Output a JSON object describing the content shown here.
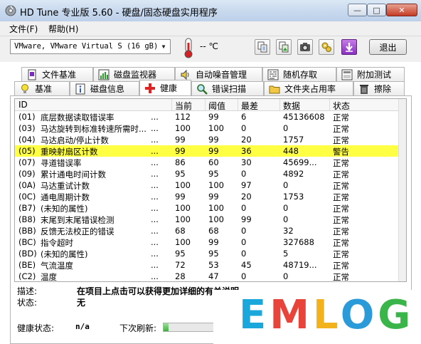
{
  "window": {
    "title": "HD Tune 专业版 5.60 - 硬盘/固态硬盘实用程序",
    "btn_min": "—",
    "btn_max": "□",
    "btn_close": "✕"
  },
  "menu": {
    "file": "文件(F)",
    "help": "帮助(H)"
  },
  "toolbar": {
    "drive": "VMware, VMware Virtual S (16 gB)",
    "temperature": "-- ℃",
    "exit": "退出"
  },
  "tabs_top": [
    {
      "label": "文件基准",
      "icon": "file-benchmark-icon"
    },
    {
      "label": "磁盘监视器",
      "icon": "disk-monitor-icon"
    },
    {
      "label": "自动噪音管理",
      "icon": "speaker-icon"
    },
    {
      "label": "随机存取",
      "icon": "random-access-icon"
    },
    {
      "label": "附加测试",
      "icon": "extra-tests-icon"
    }
  ],
  "tabs_bottom": [
    {
      "label": "基准",
      "icon": "lightbulb-icon"
    },
    {
      "label": "磁盘信息",
      "icon": "info-icon"
    },
    {
      "label": "健康",
      "icon": "health-cross-icon"
    },
    {
      "label": "错误扫描",
      "icon": "magnifier-icon"
    },
    {
      "label": "文件夹占用率",
      "icon": "folder-icon"
    },
    {
      "label": "擦除",
      "icon": "trash-icon"
    }
  ],
  "table": {
    "columns": [
      "ID",
      "当前",
      "阈值",
      "最差",
      "数据",
      "状态"
    ],
    "rows": [
      {
        "id": "(01)",
        "name": "底层数据读取错误率",
        "dots": "...",
        "current": "112",
        "threshold": "99",
        "worst": "6",
        "data": "45136608",
        "status": "正常"
      },
      {
        "id": "(03)",
        "name": "马达旋转到标准转速所需时...",
        "dots": "...",
        "current": "100",
        "threshold": "100",
        "worst": "0",
        "data": "0",
        "status": "正常"
      },
      {
        "id": "(04)",
        "name": "马达启动/停止计数",
        "dots": "...",
        "current": "99",
        "threshold": "99",
        "worst": "20",
        "data": "1757",
        "status": "正常"
      },
      {
        "id": "(05)",
        "name": "重映射扇区计数",
        "dots": "...",
        "current": "99",
        "threshold": "99",
        "worst": "36",
        "data": "448",
        "status": "警告"
      },
      {
        "id": "(07)",
        "name": "寻道错误率",
        "dots": "...",
        "current": "86",
        "threshold": "60",
        "worst": "30",
        "data": "45699...",
        "status": "正常"
      },
      {
        "id": "(09)",
        "name": "累计通电时间计数",
        "dots": "...",
        "current": "95",
        "threshold": "95",
        "worst": "0",
        "data": "4892",
        "status": "正常"
      },
      {
        "id": "(0A)",
        "name": "马达重试计数",
        "dots": "...",
        "current": "100",
        "threshold": "100",
        "worst": "97",
        "data": "0",
        "status": "正常"
      },
      {
        "id": "(0C)",
        "name": "通电周期计数",
        "dots": "...",
        "current": "99",
        "threshold": "99",
        "worst": "20",
        "data": "1753",
        "status": "正常"
      },
      {
        "id": "(B7)",
        "name": "(未知的属性)",
        "dots": "...",
        "current": "100",
        "threshold": "100",
        "worst": "0",
        "data": "0",
        "status": "正常"
      },
      {
        "id": "(B8)",
        "name": "末尾到末尾错误检测",
        "dots": "...",
        "current": "100",
        "threshold": "100",
        "worst": "99",
        "data": "0",
        "status": "正常"
      },
      {
        "id": "(BB)",
        "name": "反馈无法校正的错误",
        "dots": "...",
        "current": "68",
        "threshold": "68",
        "worst": "0",
        "data": "32",
        "status": "正常"
      },
      {
        "id": "(BC)",
        "name": "指令超时",
        "dots": "...",
        "current": "100",
        "threshold": "99",
        "worst": "0",
        "data": "327688",
        "status": "正常"
      },
      {
        "id": "(BD)",
        "name": "(未知的属性)",
        "dots": "...",
        "current": "95",
        "threshold": "95",
        "worst": "0",
        "data": "5",
        "status": "正常"
      },
      {
        "id": "(BE)",
        "name": "气流温度",
        "dots": "...",
        "current": "72",
        "threshold": "53",
        "worst": "45",
        "data": "48719...",
        "status": "正常"
      },
      {
        "id": "(C2)",
        "name": "温度",
        "dots": "...",
        "current": "28",
        "threshold": "47",
        "worst": "0",
        "data": "0",
        "status": "正常"
      }
    ]
  },
  "details": {
    "desc_label": "描述:",
    "desc_value": "在项目上点击可以获得更加详细的有关说明",
    "status_label": "状态:",
    "status_value": "无"
  },
  "footer": {
    "health_label": "健康状态:",
    "health_value": "n/a",
    "refresh_label": "下次刷新:",
    "refresh_progress": 0.1
  },
  "watermark": {
    "letters": [
      "E",
      "M",
      "L",
      "O",
      "G"
    ],
    "colors": [
      "#1aa8dc",
      "#e8443a",
      "#f2b21c",
      "#2a9bd8",
      "#39b54a"
    ]
  },
  "colors": {
    "selected_row": "#ffff44"
  }
}
